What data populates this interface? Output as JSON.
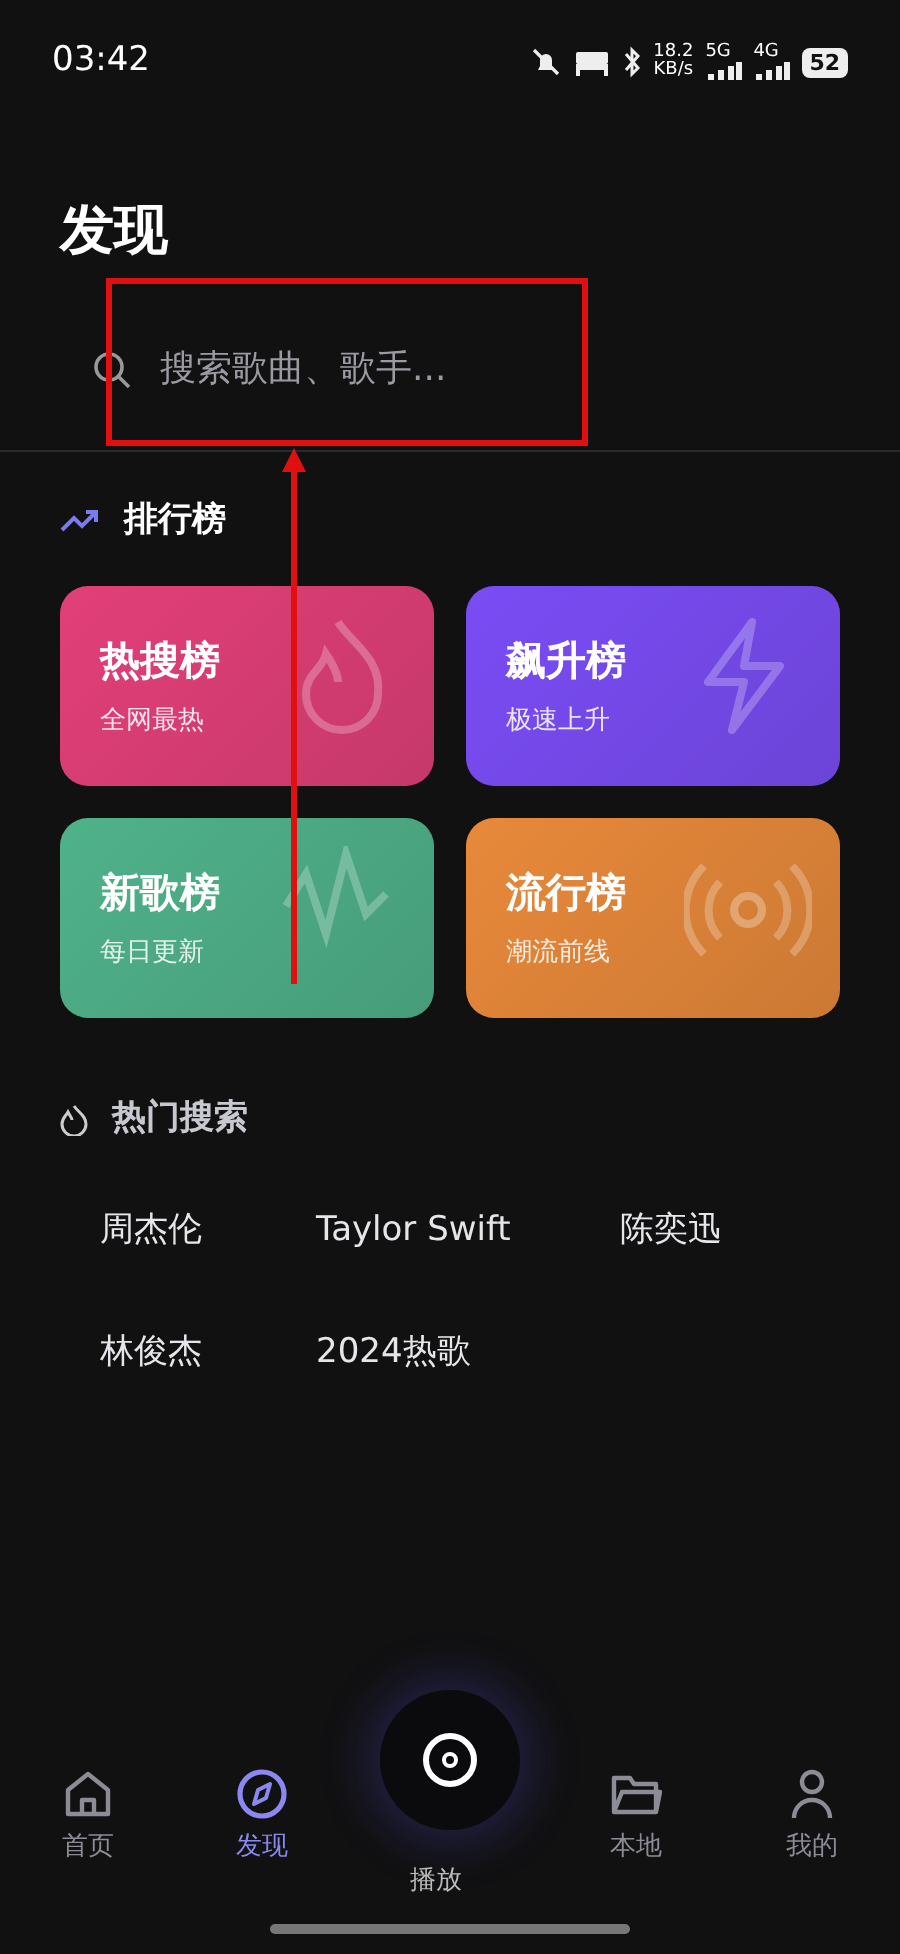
{
  "status_bar": {
    "time": "03:42",
    "speed": "18.2",
    "speed_unit": "KB/s",
    "net1": "5G",
    "net2": "4G",
    "battery": "52"
  },
  "page_title": "发现",
  "search": {
    "placeholder": "搜索歌曲、歌手..."
  },
  "charts_section": {
    "title": "排行榜",
    "cards": [
      {
        "title": "热搜榜",
        "subtitle": "全网最热",
        "color": "#e23f78",
        "kind": "flame"
      },
      {
        "title": "飙升榜",
        "subtitle": "极速上升",
        "color": "#7a4cf5",
        "kind": "bolt"
      },
      {
        "title": "新歌榜",
        "subtitle": "每日更新",
        "color": "#4fb28a",
        "kind": "wave"
      },
      {
        "title": "流行榜",
        "subtitle": "潮流前线",
        "color": "#e8893a",
        "kind": "radio"
      }
    ]
  },
  "hot_section": {
    "title": "热门搜索",
    "terms": [
      "周杰伦",
      "Taylor Swift",
      "陈奕迅",
      "林俊杰",
      "2024热歌"
    ]
  },
  "tab_bar": [
    {
      "label": "首页",
      "kind": "home",
      "selected": false
    },
    {
      "label": "发现",
      "kind": "compass",
      "selected": true
    },
    {
      "label": "播放",
      "kind": "play",
      "selected": false
    },
    {
      "label": "本地",
      "kind": "folder",
      "selected": false
    },
    {
      "label": "我的",
      "kind": "user",
      "selected": false
    }
  ]
}
